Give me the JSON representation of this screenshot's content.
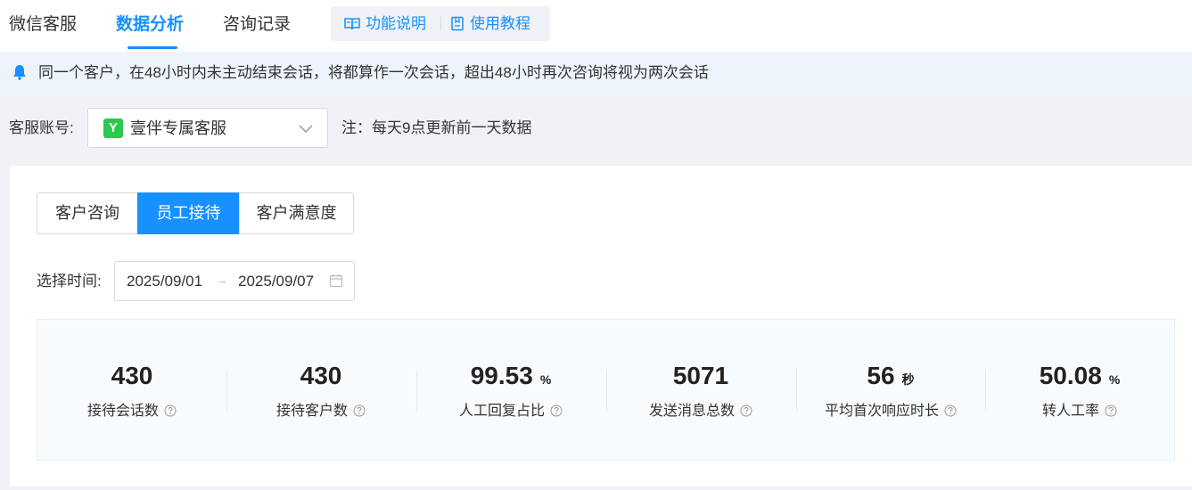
{
  "tabs": [
    {
      "label": "微信客服",
      "active": false
    },
    {
      "label": "数据分析",
      "active": true
    },
    {
      "label": "咨询记录",
      "active": false
    }
  ],
  "help": {
    "feature_label": "功能说明",
    "tutorial_label": "使用教程",
    "icons": [
      "book-icon",
      "document-icon"
    ]
  },
  "notice": {
    "text": "同一个客户，在48小时内未主动结束会话，将都算作一次会话，超出48小时再次咨询将视为两次会话",
    "icon": "bell-icon"
  },
  "account": {
    "label": "客服账号:",
    "logo_text": "Y",
    "selected": "壹伴专属客服",
    "note": "注：每天9点更新前一天数据"
  },
  "segments": [
    {
      "label": "客户咨询",
      "active": false
    },
    {
      "label": "员工接待",
      "active": true
    },
    {
      "label": "客户满意度",
      "active": false
    }
  ],
  "time": {
    "label": "选择时间:",
    "start": "2025/09/01",
    "arrow": "→",
    "end": "2025/09/07"
  },
  "stats": [
    {
      "value": "430",
      "unit": "",
      "label": "接待会话数"
    },
    {
      "value": "430",
      "unit": "",
      "label": "接待客户数"
    },
    {
      "value": "99.53",
      "unit": "%",
      "label": "人工回复占比"
    },
    {
      "value": "5071",
      "unit": "",
      "label": "发送消息总数"
    },
    {
      "value": "56",
      "unit": "秒",
      "label": "平均首次响应时长"
    },
    {
      "value": "50.08",
      "unit": "%",
      "label": "转人工率"
    }
  ],
  "colors": {
    "accent": "#1890ff",
    "logo_green": "#2dc84d",
    "notice_bg": "#edf4fc"
  }
}
